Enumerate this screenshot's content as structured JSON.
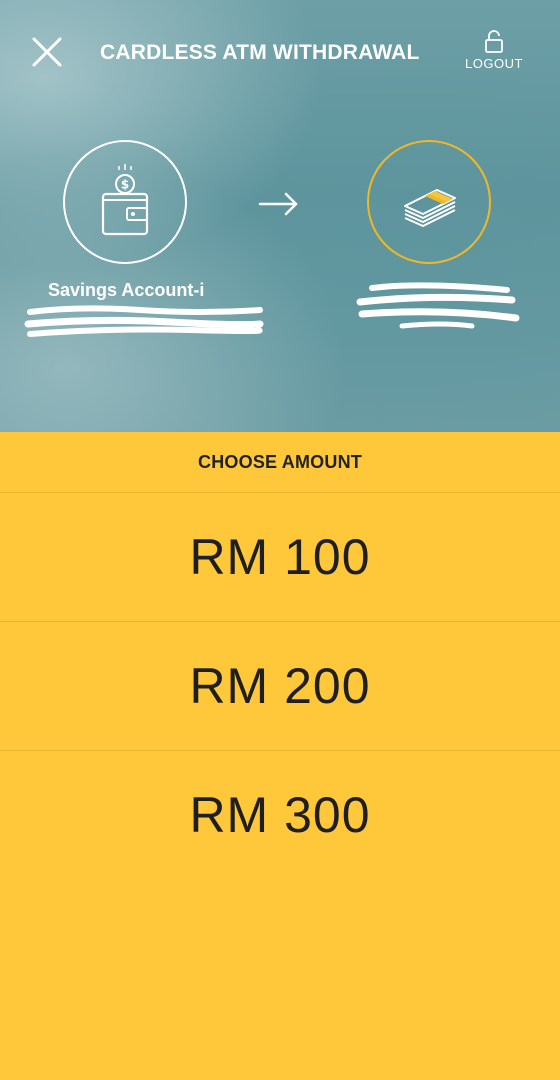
{
  "header": {
    "title": "CARDLESS ATM WITHDRAWAL",
    "logout_label": "LOGOUT",
    "close_icon": "close-icon",
    "logout_icon": "unlock-icon"
  },
  "transfer": {
    "from_icon": "wallet-coin-icon",
    "to_icon": "cash-stack-icon",
    "arrow_icon": "arrow-right-icon",
    "from_account_name": "Savings Account-i"
  },
  "amounts": {
    "heading": "CHOOSE AMOUNT",
    "options": [
      "RM 100",
      "RM 200",
      "RM 300"
    ]
  },
  "colors": {
    "accent": "#ffc83a",
    "ring_highlight": "#f0b826",
    "header_bg": "#5e949c"
  }
}
